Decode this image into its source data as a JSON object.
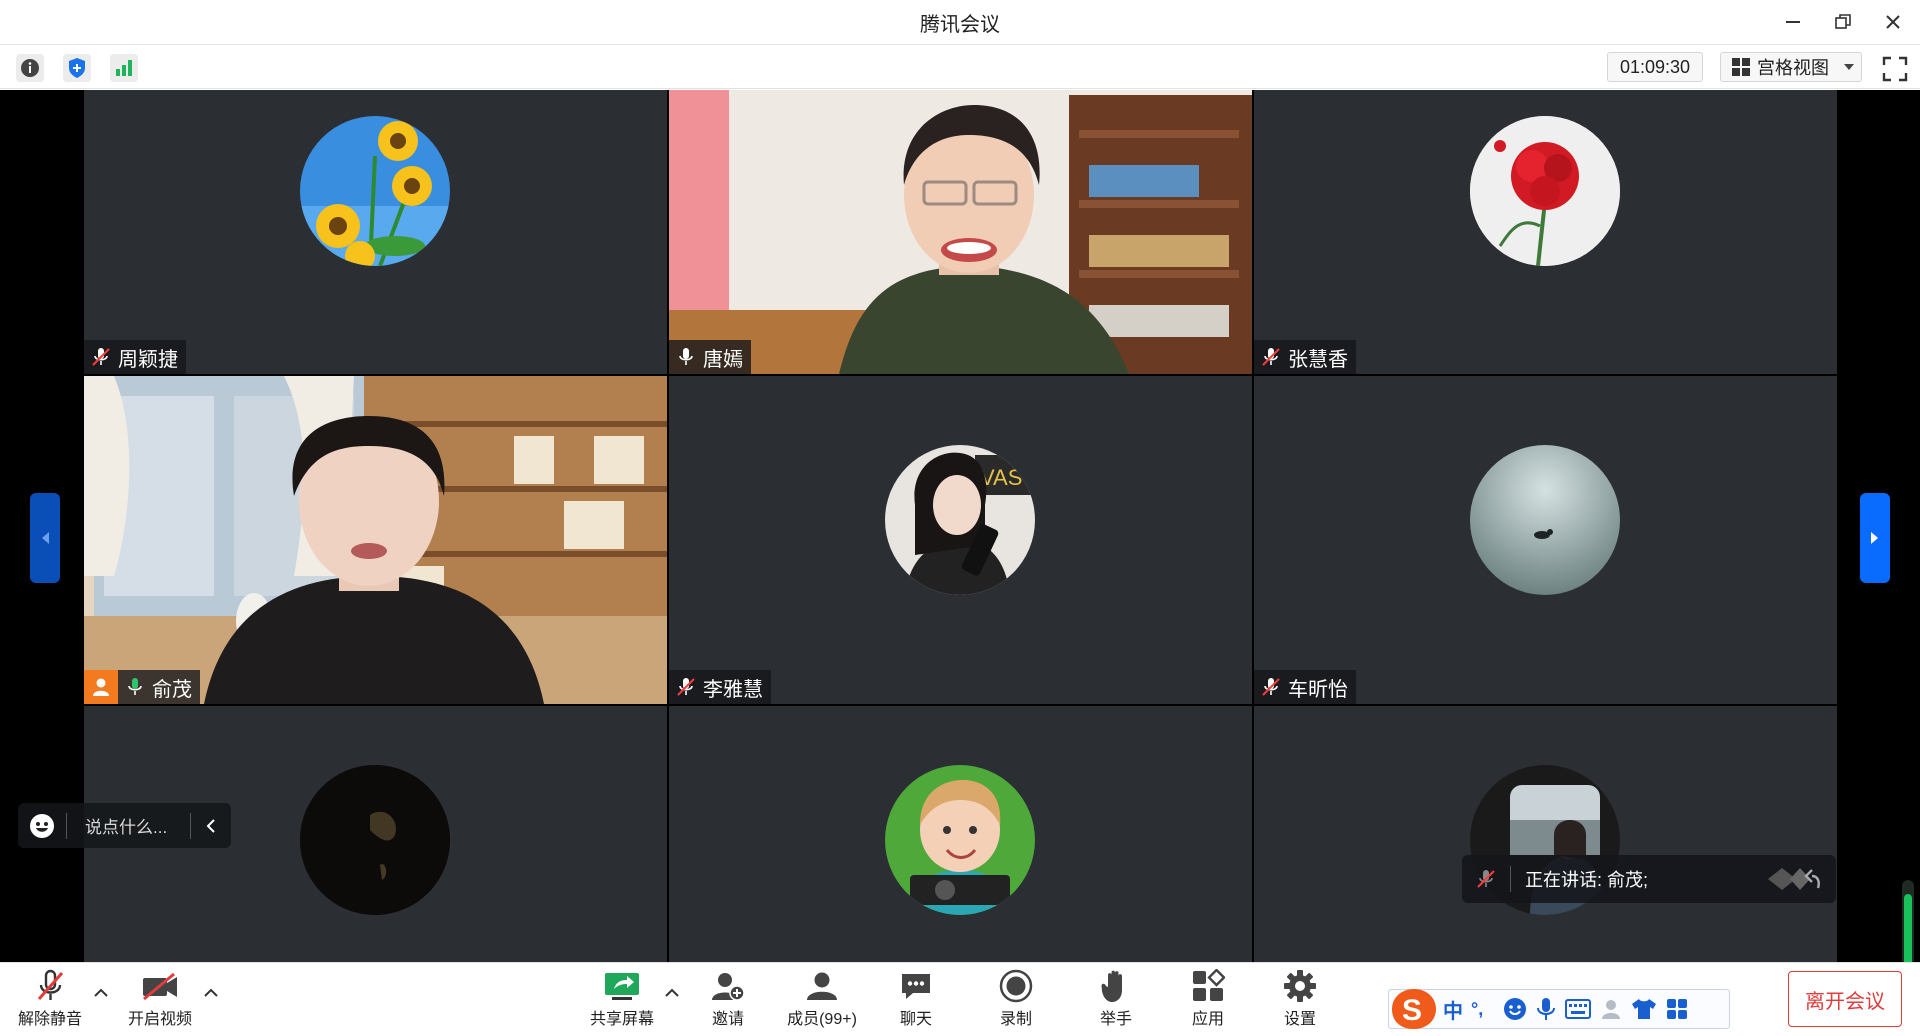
{
  "window": {
    "title": "腾讯会议"
  },
  "topbar": {
    "timer": "01:09:30",
    "view_mode": "宫格视图",
    "icons": [
      "info-icon",
      "shield-icon",
      "network-signal-icon",
      "grid-icon",
      "fullscreen-icon"
    ]
  },
  "participants": [
    {
      "name": "周颖捷",
      "mic": "muted",
      "avatar": "sunflower"
    },
    {
      "name": "唐嫣",
      "mic": "on",
      "video": "on"
    },
    {
      "name": "张慧香",
      "mic": "muted",
      "avatar": "red-carnation"
    },
    {
      "name": "俞茂",
      "mic": "on",
      "video": "on",
      "host": true,
      "speaking": true
    },
    {
      "name": "李雅慧",
      "mic": "muted",
      "avatar": "woman-portrait"
    },
    {
      "name": "车昕怡",
      "mic": "muted",
      "avatar": "water-duck"
    },
    {
      "name": "",
      "avatar": "dark-hand"
    },
    {
      "name": "",
      "avatar": "toddler"
    },
    {
      "name": "",
      "avatar": "car-window"
    }
  ],
  "chat": {
    "placeholder": "说点什么..."
  },
  "speaking_indicator": {
    "label": "正在讲话: 俞茂;"
  },
  "toolbar": {
    "mute": "解除静音",
    "video": "开启视频",
    "share": "共享屏幕",
    "invite": "邀请",
    "members": "成员(99+)",
    "chat": "聊天",
    "record": "录制",
    "raise_hand": "举手",
    "apps": "应用",
    "settings": "设置",
    "leave": "离开会议"
  },
  "ime": {
    "mode": "中",
    "punct": "°,"
  },
  "colors": {
    "accent": "#0a6cff",
    "leave": "#e03c3c",
    "active_outline": "#2fc36b",
    "tile_bg": "#2b2e33"
  }
}
